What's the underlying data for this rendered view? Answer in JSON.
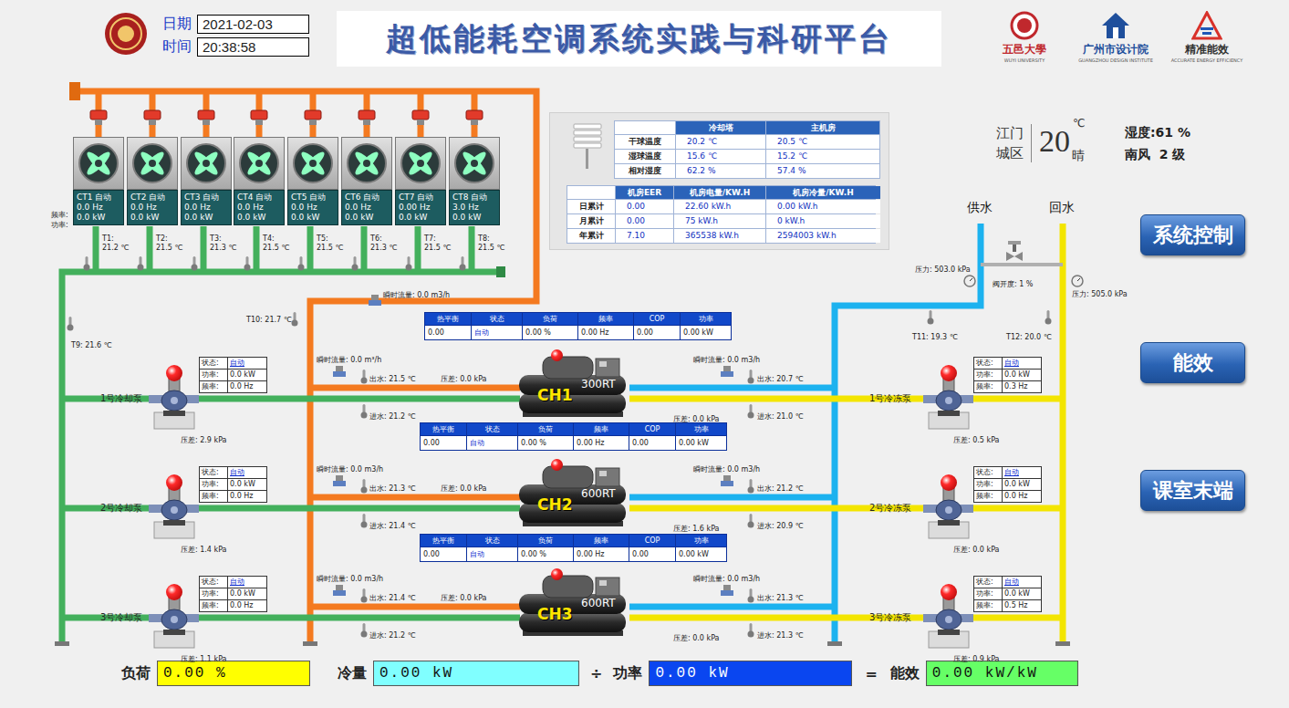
{
  "header": {
    "date_label": "日期",
    "date": "2021-02-03",
    "time_label": "时间",
    "time": "20:38:58",
    "title": "超低能耗空调系统实践与科研平台",
    "logos": [
      {
        "name": "五邑大學",
        "sub": "WUYI UNIVERSITY",
        "color": "#c0282d"
      },
      {
        "name": "广州市设计院",
        "sub": "GUANGZHOU DESIGN INSTITUTE",
        "color": "#1f4f9c"
      },
      {
        "name": "精准能效",
        "sub": "ACCURATE ENERGY EFFICIENCY",
        "color": "#333333"
      }
    ]
  },
  "cooling_towers": {
    "freq_label": "频率:",
    "power_label": "功率:",
    "items": [
      {
        "name": "CT1",
        "mode": "自动",
        "freq": "0.0 Hz",
        "power": "0.0 kW",
        "temp_label": "T1:",
        "temp": "21.2 ℃"
      },
      {
        "name": "CT2",
        "mode": "自动",
        "freq": "0.0 Hz",
        "power": "0.0 kW",
        "temp_label": "T2:",
        "temp": "21.5 ℃"
      },
      {
        "name": "CT3",
        "mode": "自动",
        "freq": "0.0 Hz",
        "power": "0.0 kW",
        "temp_label": "T3:",
        "temp": "21.3 ℃"
      },
      {
        "name": "CT4",
        "mode": "自动",
        "freq": "0.0 Hz",
        "power": "0.0 kW",
        "temp_label": "T4:",
        "temp": "21.5 ℃"
      },
      {
        "name": "CT5",
        "mode": "自动",
        "freq": "0.0 Hz",
        "power": "0.0 kW",
        "temp_label": "T5:",
        "temp": "21.5 ℃"
      },
      {
        "name": "CT6",
        "mode": "自动",
        "freq": "0.0 Hz",
        "power": "0.0 kW",
        "temp_label": "T6:",
        "temp": "21.3 ℃"
      },
      {
        "name": "CT7",
        "mode": "自动",
        "freq": "0.00 Hz",
        "power": "0.0 kW",
        "temp_label": "T7:",
        "temp": "21.5 ℃"
      },
      {
        "name": "CT8",
        "mode": "自动",
        "freq": "3.0 Hz",
        "power": "0.0 kW",
        "temp_label": "T8:",
        "temp": "21.5 ℃"
      }
    ]
  },
  "env_table": {
    "headers": [
      "",
      "冷却塔",
      "主机房"
    ],
    "rows": [
      [
        "干球温度",
        "20.2 ℃",
        "20.5 ℃"
      ],
      [
        "湿球温度",
        "15.6 ℃",
        "15.2 ℃"
      ],
      [
        "相对湿度",
        "62.2 %",
        "57.4 %"
      ]
    ]
  },
  "energy_table": {
    "headers": [
      "",
      "机房EER",
      "机房电量/KW.H",
      "机房冷量/KW.H"
    ],
    "rows": [
      [
        "日累计",
        "0.00",
        "22.60 kW.h",
        "0.00 kW.h"
      ],
      [
        "月累计",
        "0.00",
        "75 kW.h",
        "0 kW.h"
      ],
      [
        "年累计",
        "7.10",
        "365538 kW.h",
        "2594003 kW.h"
      ]
    ]
  },
  "weather": {
    "city": "江门",
    "district": "城区",
    "temp": "20",
    "unit": "℃",
    "condition": "晴",
    "humidity": "湿度:61 %",
    "wind": "南风  2 级"
  },
  "nav_buttons": [
    "系统控制",
    "能效",
    "课室末端"
  ],
  "cooling_header": {
    "flow": "瞬时流量: 0.0 m3/h",
    "t10": "T10: 21.7 ℃",
    "t9": "T9: 21.6 ℃"
  },
  "chilled_loop": {
    "supply": "供水",
    "return": "回水",
    "supply_pressure": "压力: 503.0 kPa",
    "return_pressure": "压力: 505.0 kPa",
    "valve": "阀开度: 1 %",
    "t11": "T11: 19.3 ℃",
    "t12": "T12: 20.0 ℃"
  },
  "status_headers": [
    "热平衡",
    "状态",
    "负荷",
    "频率",
    "COP",
    "功率"
  ],
  "chillers": [
    {
      "name": "CH1",
      "capacity": "300RT",
      "running": false,
      "status": [
        "0.00",
        "自动",
        "0.00 %",
        "0.00 Hz",
        "0.00",
        "0.00 kW"
      ],
      "cond_flow": "瞬时流量: 0.0 m³/h",
      "cond_out": "出水: 21.5 ℃",
      "cond_dp": "压差: 0.0 kPa",
      "cond_in": "进水: 21.2 ℃",
      "evap_flow": "瞬时流量: 0.0 m3/h",
      "evap_out": "出水: 20.7 ℃",
      "evap_dp": "压差: 0.0 kPa",
      "evap_in": "进水: 21.0 ℃"
    },
    {
      "name": "CH2",
      "capacity": "600RT",
      "running": false,
      "status": [
        "0.00",
        "自动",
        "0.00 %",
        "0.00 Hz",
        "0.00",
        "0.00 kW"
      ],
      "cond_flow": "瞬时流量: 0.0 m3/h",
      "cond_out": "出水: 21.3 ℃",
      "cond_dp": "压差: 0.0 kPa",
      "cond_in": "进水: 21.4 ℃",
      "evap_flow": "瞬时流量: 0.0 m3/h",
      "evap_out": "出水: 21.2 ℃",
      "evap_dp": "压差: 1.6 kPa",
      "evap_in": "进水: 20.9 ℃"
    },
    {
      "name": "CH3",
      "capacity": "600RT",
      "running": false,
      "status": [
        "0.00",
        "自动",
        "0.00 %",
        "0.00 Hz",
        "0.00",
        "0.00 kW"
      ],
      "cond_flow": "瞬时流量: 0.0 m3/h",
      "cond_out": "出水: 21.4 ℃",
      "cond_dp": "压差: 0.0 kPa",
      "cond_in": "进水: 21.2 ℃",
      "evap_flow": "瞬时流量: 0.0 m3/h",
      "evap_out": "出水: 21.3 ℃",
      "evap_dp": "压差: 0.0 kPa",
      "evap_in": "进水: 21.3 ℃"
    }
  ],
  "pump_labels": {
    "status": "状态:",
    "power": "功率:",
    "freq": "频率:"
  },
  "cooling_pumps": [
    {
      "name": "1号冷却泵",
      "status": "自动",
      "power": "0.0 kW",
      "freq": "0.0 Hz",
      "dp": "压差: 2.9 kPa",
      "running": false
    },
    {
      "name": "2号冷却泵",
      "status": "自动",
      "power": "0.0 kW",
      "freq": "0.0 Hz",
      "dp": "压差: 1.4 kPa",
      "running": false
    },
    {
      "name": "3号冷却泵",
      "status": "自动",
      "power": "0.0 kW",
      "freq": "0.0 Hz",
      "dp": "压差: 1.1 kPa",
      "running": false
    }
  ],
  "chilled_pumps": [
    {
      "name": "1号冷冻泵",
      "status": "自动",
      "power": "0.0 kW",
      "freq": "0.3 Hz",
      "dp": "压差: 0.5 kPa",
      "running": false
    },
    {
      "name": "2号冷冻泵",
      "status": "自动",
      "power": "0.0 kW",
      "freq": "0.0 Hz",
      "dp": "压差: 0.0 kPa",
      "running": false
    },
    {
      "name": "3号冷冻泵",
      "status": "自动",
      "power": "0.0 kW",
      "freq": "0.5 Hz",
      "dp": "压差: 0.9 kPa",
      "running": false
    }
  ],
  "summary": {
    "load_label": "负荷",
    "load": "0.00 %",
    "cooling_label": "冷量",
    "cooling": "0.00 kW",
    "divide": "÷",
    "power_label": "功率",
    "power": "0.00 kW",
    "equals": "=",
    "eff_label": "能效",
    "eff": "0.00 kW/kW"
  }
}
